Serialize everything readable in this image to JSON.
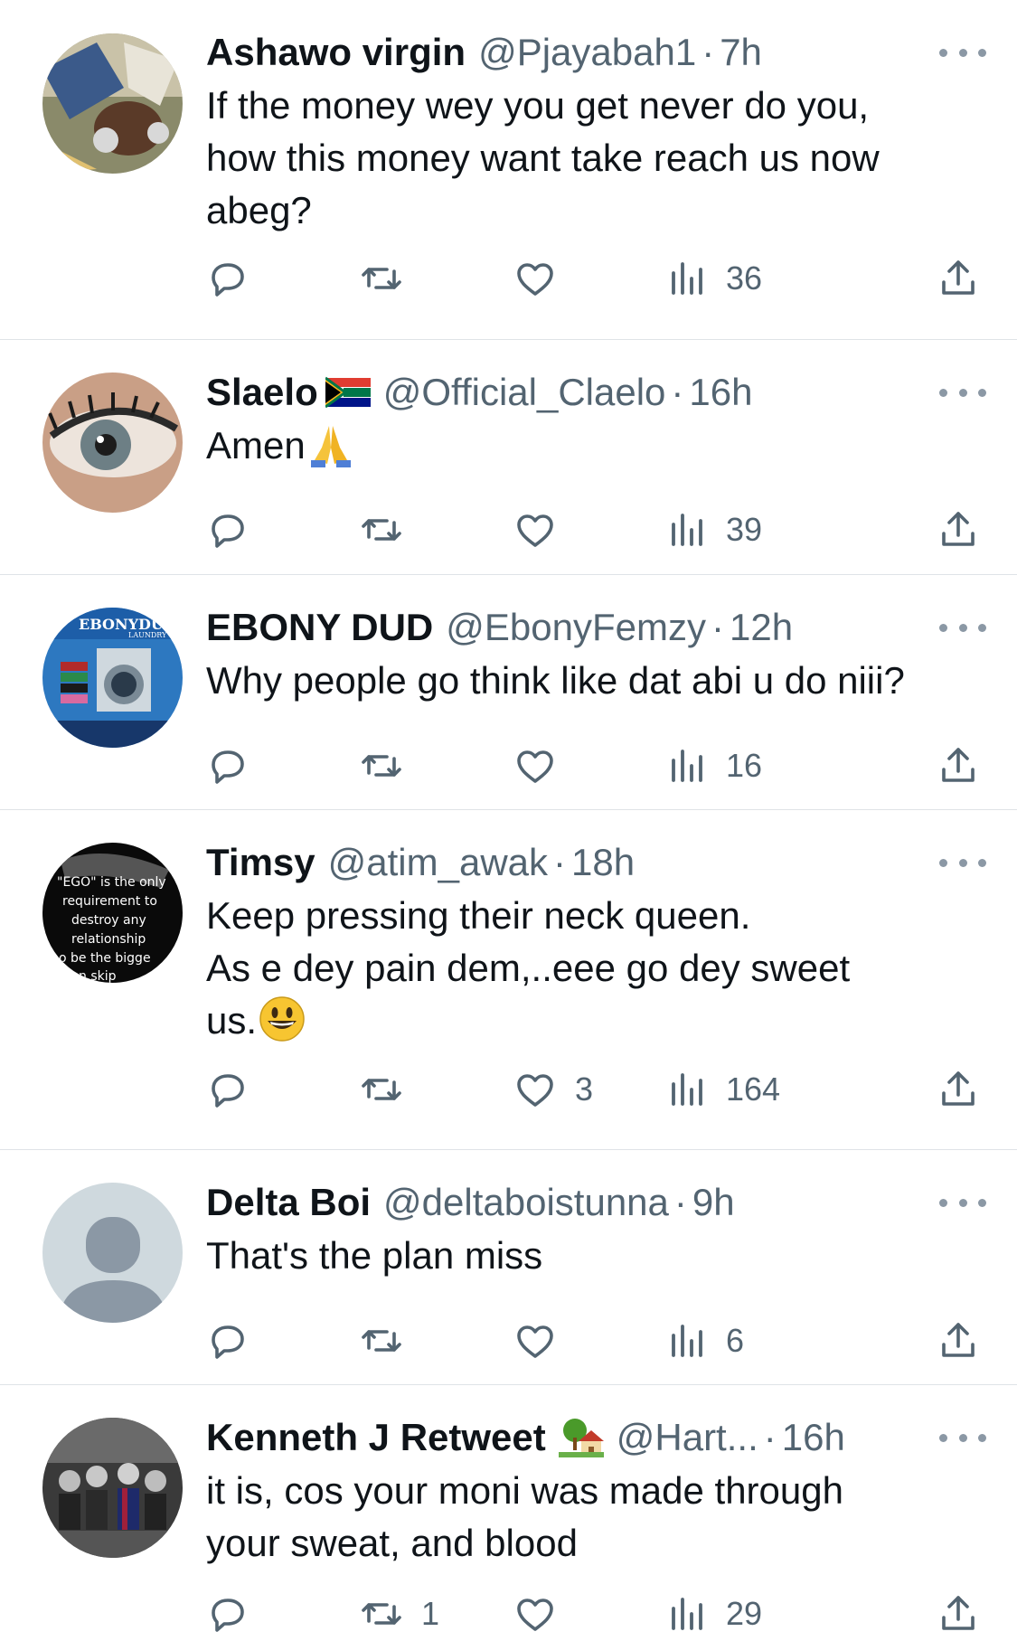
{
  "tweets": [
    {
      "name": "Ashawo virgin",
      "handle": "@Pjayabah1",
      "time": "7h",
      "text_lines": [
        "If the money wey you get never do you,",
        "how this money want take reach us now",
        "abeg?"
      ],
      "reply_count": "",
      "retweet_count": "",
      "like_count": "",
      "view_count": "36"
    },
    {
      "name": "Slaelo",
      "name_emoji": "south-africa-flag",
      "handle": "@Official_Claelo",
      "time": "16h",
      "text_lines": [
        "Amen"
      ],
      "text_emoji": "folded-hands",
      "reply_count": "",
      "retweet_count": "",
      "like_count": "",
      "view_count": "39"
    },
    {
      "name": "EBONY DUD",
      "handle": "@EbonyFemzy",
      "time": "12h",
      "text_lines": [
        "Why people go think like dat abi u do niii?"
      ],
      "avatar_text": [
        "EBONYDU",
        "LAUNDRY"
      ],
      "reply_count": "",
      "retweet_count": "",
      "like_count": "",
      "view_count": "16"
    },
    {
      "name": "Timsy",
      "handle": "@atim_awak",
      "time": "18h",
      "text_lines": [
        "Keep pressing their neck queen.",
        "As e dey pain dem,..eee go dey sweet",
        "us."
      ],
      "text_emoji": "grinning-face",
      "avatar_text": [
        "\"EGO\" is the only",
        "requirement to",
        "destroy any",
        "relationship",
        "o be the bigge",
        "n skip"
      ],
      "reply_count": "",
      "retweet_count": "",
      "like_count": "3",
      "view_count": "164"
    },
    {
      "name": "Delta Boi",
      "handle": "@deltaboistunna",
      "time": "9h",
      "text_lines": [
        "That's the plan miss"
      ],
      "reply_count": "",
      "retweet_count": "",
      "like_count": "",
      "view_count": "6"
    },
    {
      "name": "Kenneth J Retweet",
      "name_emoji": "house-with-garden",
      "handle": "@Hart...",
      "time": "16h",
      "text_lines": [
        "it is, cos your moni was made through",
        "your sweat, and blood"
      ],
      "reply_count": "",
      "retweet_count": "1",
      "like_count": "",
      "view_count": "29"
    }
  ],
  "icons": {
    "reply": "reply-icon",
    "retweet": "retweet-icon",
    "like": "heart-icon",
    "views": "views-icon",
    "share": "share-icon",
    "more": "more-icon"
  },
  "colors": {
    "text": "#0f1419",
    "secondary": "#536471",
    "divider": "#dfe3e7",
    "default_avatar_bg": "#cfd9de",
    "default_avatar_fg": "#8b98a5"
  }
}
